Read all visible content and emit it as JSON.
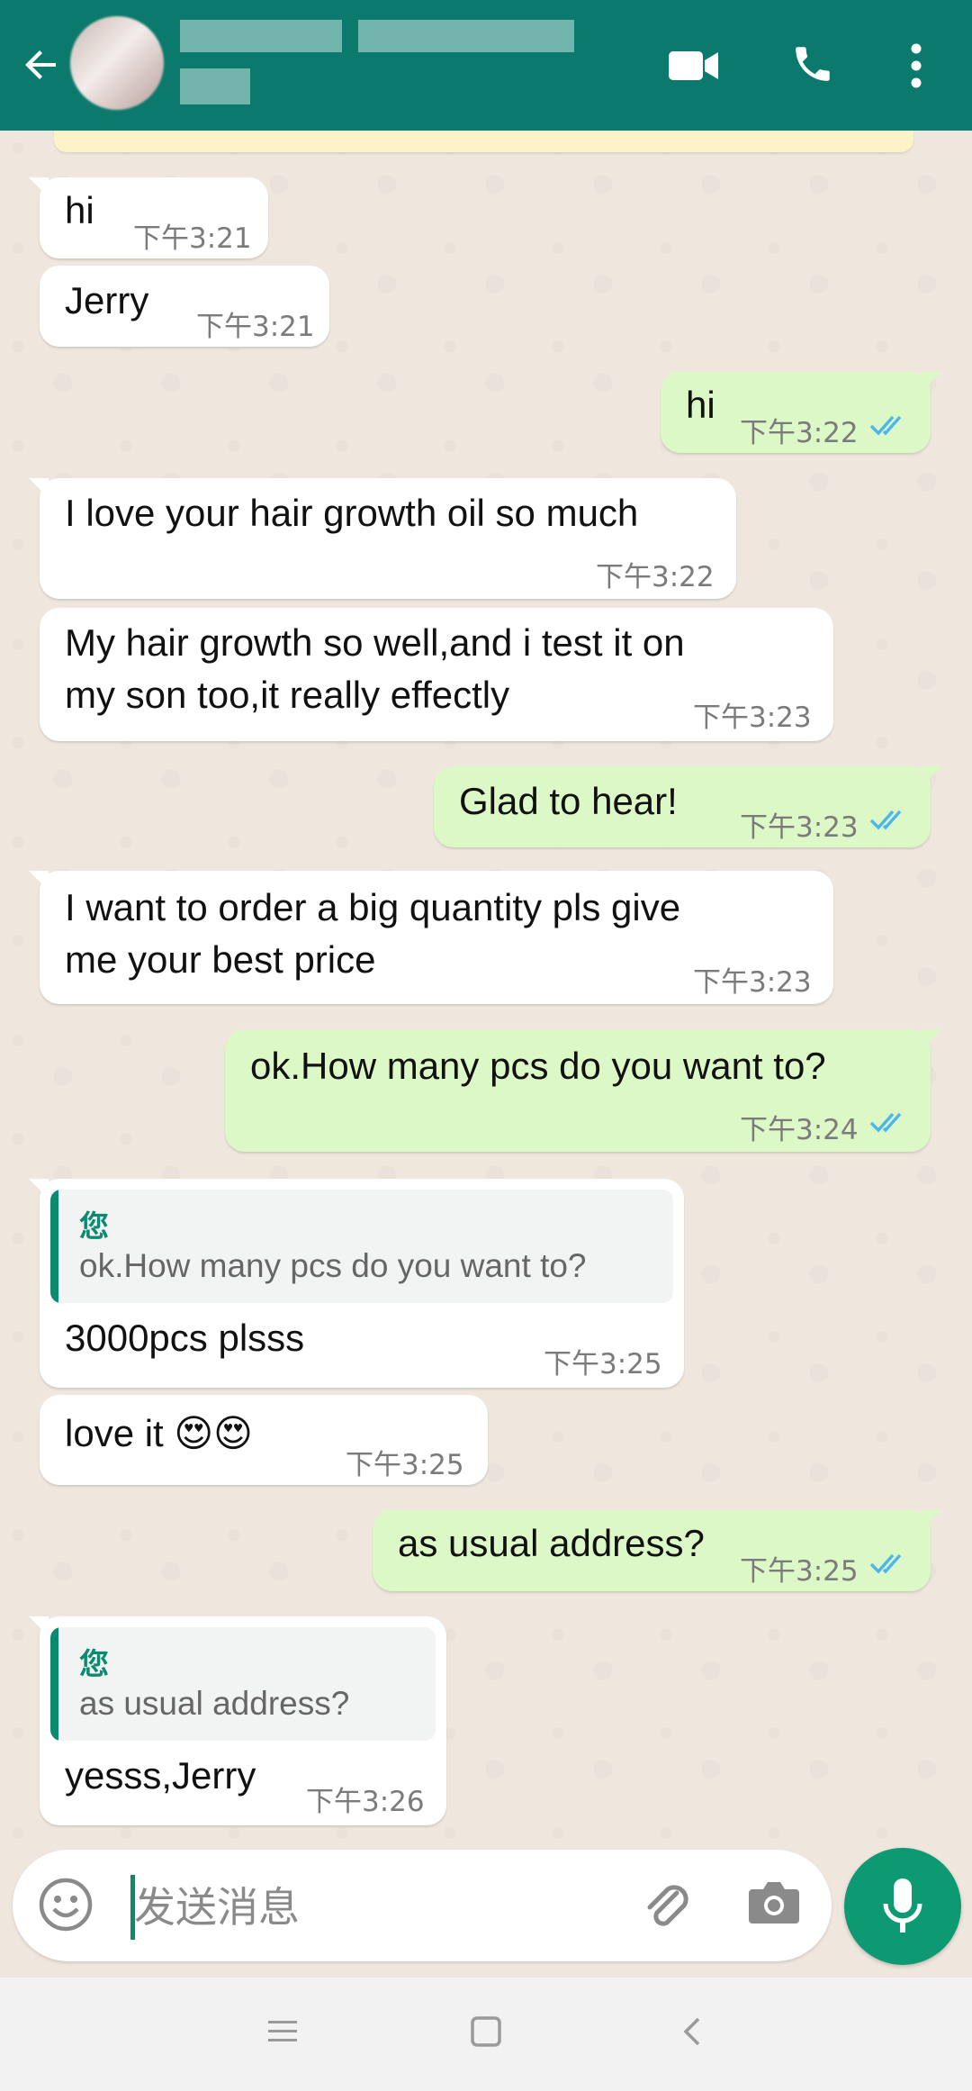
{
  "header": {
    "back_icon": "arrow-left-icon",
    "video_icon": "video-call-icon",
    "call_icon": "phone-icon",
    "menu_icon": "more-vert-icon",
    "bg_color": "#0b7a6d"
  },
  "messages": [
    {
      "dir": "in",
      "text": "hi",
      "time": "下午3:21"
    },
    {
      "dir": "in",
      "text": "Jerry",
      "time": "下午3:21"
    },
    {
      "dir": "out",
      "text": "hi",
      "time": "下午3:22",
      "status": "read"
    },
    {
      "dir": "in",
      "text": "I love your hair growth oil so much",
      "time": "下午3:22"
    },
    {
      "dir": "in",
      "line1": "My hair growth so well,and i test it on",
      "line2": "my son too,it really effectly",
      "time": "下午3:23"
    },
    {
      "dir": "out",
      "text": "Glad to hear!",
      "time": "下午3:23",
      "status": "read"
    },
    {
      "dir": "in",
      "line1": "I want to order a big quantity pls give",
      "line2": "me your best price",
      "time": "下午3:23"
    },
    {
      "dir": "out",
      "text": "ok.How many pcs do you want to?",
      "time": "下午3:24",
      "status": "read"
    },
    {
      "dir": "in",
      "quote_author": "您",
      "quote_text": "ok.How many pcs do you want to?",
      "text": "3000pcs plsss",
      "time": "下午3:25"
    },
    {
      "dir": "in",
      "text": "love it 😍😍",
      "time": "下午3:25"
    },
    {
      "dir": "out",
      "text": "as usual address?",
      "time": "下午3:25",
      "status": "read"
    },
    {
      "dir": "in",
      "quote_author": "您",
      "quote_text": "as usual address?",
      "text": "yesss,Jerry",
      "time": "下午3:26"
    }
  ],
  "composer": {
    "placeholder": "发送消息",
    "emoji_icon": "emoji-icon",
    "attach_icon": "paperclip-icon",
    "camera_icon": "camera-icon",
    "mic_icon": "microphone-icon"
  },
  "colors": {
    "incoming": "#ffffff",
    "outgoing": "#dcf8c6",
    "read_ticks": "#4fb6ec",
    "accent": "#0d9a72"
  }
}
